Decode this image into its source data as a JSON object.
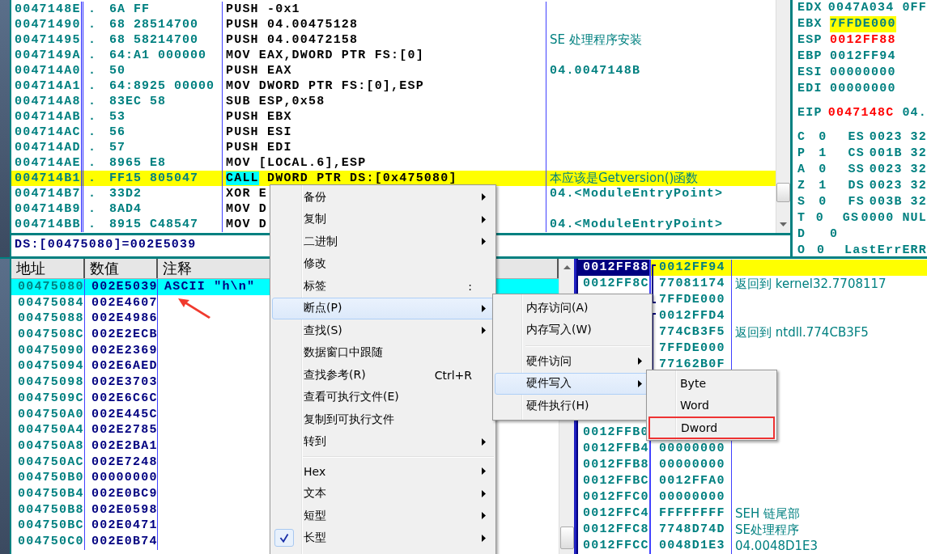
{
  "disassembly": {
    "rows": [
      {
        "address": "0047148E",
        "dot": ".",
        "hex": "6A FF",
        "mnemonic": "PUSH",
        "operands": "-0x1",
        "selected": false
      },
      {
        "address": "00471490",
        "dot": ".",
        "hex": "68 28514700",
        "mnemonic": "PUSH",
        "operands": "04.00475128",
        "selected": false
      },
      {
        "address": "00471495",
        "dot": ".",
        "hex": "68 58214700",
        "mnemonic": "PUSH",
        "operands": "04.00472158",
        "comment": "SE 处理程序安装",
        "selected": false
      },
      {
        "address": "0047149A",
        "dot": ".",
        "hex": "64:A1 000000",
        "mnemonic": "MOV",
        "operands": "EAX,DWORD PTR FS:[0]",
        "selected": false
      },
      {
        "address": "004714A0",
        "dot": ".",
        "hex": "50",
        "mnemonic": "PUSH",
        "operands": "EAX",
        "comment": "04.0047148B",
        "selected": false
      },
      {
        "address": "004714A1",
        "dot": ".",
        "hex": "64:8925 00000",
        "mnemonic": "MOV",
        "operands": "DWORD PTR FS:[0],ESP",
        "selected": false
      },
      {
        "address": "004714A8",
        "dot": ".",
        "hex": "83EC 58",
        "mnemonic": "SUB",
        "operands": "ESP,0x58",
        "selected": false
      },
      {
        "address": "004714AB",
        "dot": ".",
        "hex": "53",
        "mnemonic": "PUSH",
        "operands": "EBX",
        "selected": false
      },
      {
        "address": "004714AC",
        "dot": ".",
        "hex": "56",
        "mnemonic": "PUSH",
        "operands": "ESI",
        "selected": false
      },
      {
        "address": "004714AD",
        "dot": ".",
        "hex": "57",
        "mnemonic": "PUSH",
        "operands": "EDI",
        "selected": false
      },
      {
        "address": "004714AE",
        "dot": ".",
        "hex": "8965 E8",
        "mnemonic": "MOV",
        "operands": "[LOCAL.6],ESP",
        "selected": false
      },
      {
        "address": "004714B1",
        "dot": ".",
        "hex": "FF15 805047",
        "mnemonic": "CALL",
        "operands": "DWORD PTR DS:[0x475080]",
        "comment": "本应该是Getversion()函数",
        "selected": true,
        "mnemonic_marked": true
      },
      {
        "address": "004714B7",
        "dot": ".",
        "hex": "33D2",
        "mnemonic": "XOR",
        "operands": "E",
        "comment": "04.<ModuleEntryPoint>",
        "selected": false
      },
      {
        "address": "004714B9",
        "dot": ".",
        "hex": "8AD4",
        "mnemonic": "MOV",
        "operands": "D",
        "selected": false
      },
      {
        "address": "004714BB",
        "dot": ".",
        "hex": "8915 C48547",
        "mnemonic": "MOV",
        "operands": "D",
        "comment": "04.<ModuleEntryPoint>",
        "selected": false
      }
    ],
    "info": "DS:[00475080]=002E5039"
  },
  "register_groups": [
    {
      "rows": [
        {
          "name": "EDX",
          "value": "0047A034",
          "extra": "0FF",
          "kind": "plain"
        },
        {
          "name": "EBX",
          "value": "7FFDE000",
          "kind": "highlight"
        },
        {
          "name": "ESP",
          "value": "0012FF88",
          "kind": "changed"
        },
        {
          "name": "EBP",
          "value": "0012FF94",
          "kind": "plain"
        },
        {
          "name": "ESI",
          "value": "00000000",
          "kind": "plain"
        },
        {
          "name": "EDI",
          "value": "00000000",
          "kind": "plain"
        }
      ]
    },
    {
      "rows": [
        {
          "name": "EIP",
          "value": "0047148C",
          "extra": "04.",
          "kind": "changed"
        }
      ]
    },
    {
      "rows": [
        {
          "name": "C",
          "value": "0",
          "segment": "ES",
          "seg_value": "0023",
          "extra": "32",
          "kind": "flag"
        },
        {
          "name": "P",
          "value": "1",
          "segment": "CS",
          "seg_value": "001B",
          "extra": "32",
          "kind": "flag"
        },
        {
          "name": "A",
          "value": "0",
          "segment": "SS",
          "seg_value": "0023",
          "extra": "32",
          "kind": "flag"
        },
        {
          "name": "Z",
          "value": "1",
          "segment": "DS",
          "seg_value": "0023",
          "extra": "32",
          "kind": "flag"
        },
        {
          "name": "S",
          "value": "0",
          "segment": "FS",
          "seg_value": "003B",
          "extra": "32",
          "kind": "flag"
        },
        {
          "name": "T",
          "value": "0",
          "segment": "GS",
          "seg_value": "0000",
          "extra": "NUL",
          "kind": "flag"
        },
        {
          "name": "D",
          "value": "0",
          "kind": "flag"
        },
        {
          "name": "O",
          "value": "0",
          "segment": "LastErr",
          "seg_value": "ERR",
          "kind": "flag"
        }
      ]
    }
  ],
  "dump": {
    "columns": [
      "地址",
      "数值",
      "注释"
    ],
    "rows": [
      {
        "address": "00475080",
        "value": "002E5039",
        "comment": "ASCII \"h\\n\"",
        "selected": true
      },
      {
        "address": "00475084",
        "value": "002E4607",
        "selected": false
      },
      {
        "address": "00475088",
        "value": "002E4986",
        "selected": false
      },
      {
        "address": "0047508C",
        "value": "002E2ECB",
        "selected": false
      },
      {
        "address": "00475090",
        "value": "002E2369",
        "selected": false
      },
      {
        "address": "00475094",
        "value": "002E6AED",
        "selected": false
      },
      {
        "address": "00475098",
        "value": "002E3703",
        "selected": false
      },
      {
        "address": "0047509C",
        "value": "002E6C6C",
        "selected": false
      },
      {
        "address": "004750A0",
        "value": "002E445C",
        "selected": false
      },
      {
        "address": "004750A4",
        "value": "002E2785",
        "selected": false
      },
      {
        "address": "004750A8",
        "value": "002E2BA1",
        "selected": false
      },
      {
        "address": "004750AC",
        "value": "002E7248",
        "selected": false
      },
      {
        "address": "004750B0",
        "value": "00000000",
        "selected": false
      },
      {
        "address": "004750B4",
        "value": "002E0BC9",
        "selected": false
      },
      {
        "address": "004750B8",
        "value": "002E0598",
        "selected": false
      },
      {
        "address": "004750BC",
        "value": "002E0471",
        "selected": false
      },
      {
        "address": "004750C0",
        "value": "002E0B74",
        "selected": false
      }
    ]
  },
  "stack": {
    "upper_rows": [
      {
        "address": "0012FF88",
        "value": "0012FF94",
        "selected": true,
        "kind": "frame_top"
      },
      {
        "address": "0012FF8C",
        "value": "77081174",
        "comment": "返回到 kernel32.7708117",
        "selected": false,
        "kind": "frame_middle"
      },
      {
        "value": "7FFDE000",
        "selected": false,
        "kind": "frame_bottom"
      },
      {
        "value": "0012FFD4",
        "selected": false,
        "kind": "frame_top"
      },
      {
        "value": "774CB3F5",
        "comment": "返回到 ntdll.774CB3F5",
        "selected": false,
        "kind": "frame_middle"
      },
      {
        "value": "7FFDE000",
        "selected": false,
        "kind": "frame_middle"
      },
      {
        "value": "77162B0F",
        "selected": false,
        "kind": "frame_middle"
      }
    ],
    "lower_rows": [
      {
        "address": "0012FFB0",
        "selected": false
      },
      {
        "address": "0012FFB4",
        "value": "00000000",
        "selected": false
      },
      {
        "address": "0012FFB8",
        "value": "00000000",
        "selected": false
      },
      {
        "address": "0012FFBC",
        "value": "0012FFA0",
        "selected": false
      },
      {
        "address": "0012FFC0",
        "value": "00000000",
        "selected": false
      },
      {
        "address": "0012FFC4",
        "value": "FFFFFFFF",
        "comment": "SEH 链尾部",
        "selected": false
      },
      {
        "address": "0012FFC8",
        "value": "7748D74D",
        "comment": "SE处理程序",
        "selected": false
      },
      {
        "address": "0012FFCC",
        "value": "0048D1E3",
        "comment": "04.0048D1E3",
        "selected": false
      }
    ]
  },
  "context_menu": {
    "items": [
      {
        "kind": "item",
        "label": "备份",
        "submenu": true,
        "checked": false,
        "selected": false
      },
      {
        "kind": "item",
        "label": "复制",
        "submenu": true,
        "checked": false,
        "selected": false
      },
      {
        "kind": "item",
        "label": "二进制",
        "submenu": true,
        "checked": false,
        "selected": false
      },
      {
        "kind": "item",
        "label": "修改",
        "submenu": false,
        "checked": false,
        "selected": false
      },
      {
        "kind": "item",
        "label": "标签",
        "shortcut": ":",
        "submenu": false,
        "checked": false,
        "selected": false
      },
      {
        "kind": "item",
        "label": "断点(P)",
        "submenu": true,
        "checked": false,
        "selected": true
      },
      {
        "kind": "item",
        "label": "查找(S)",
        "submenu": true,
        "checked": false,
        "selected": false
      },
      {
        "kind": "item",
        "label": "数据窗口中跟随",
        "submenu": false,
        "checked": false,
        "selected": false
      },
      {
        "kind": "item",
        "label": "查找参考(R)",
        "shortcut": "Ctrl+R",
        "submenu": false,
        "checked": false,
        "selected": false
      },
      {
        "kind": "item",
        "label": "查看可执行文件(E)",
        "submenu": false,
        "checked": false,
        "selected": false
      },
      {
        "kind": "item",
        "label": "复制到可执行文件",
        "submenu": false,
        "checked": false,
        "selected": false
      },
      {
        "kind": "item",
        "label": "转到",
        "submenu": true,
        "checked": false,
        "selected": false
      },
      {
        "kind": "separator"
      },
      {
        "kind": "item",
        "label": "Hex",
        "submenu": true,
        "checked": false,
        "selected": false
      },
      {
        "kind": "item",
        "label": "文本",
        "submenu": true,
        "checked": false,
        "selected": false
      },
      {
        "kind": "item",
        "label": "短型",
        "submenu": true,
        "checked": false,
        "selected": false
      },
      {
        "kind": "item",
        "label": "长型",
        "submenu": true,
        "checked": true,
        "selected": false
      }
    ]
  },
  "breakpoint_menu": {
    "items": [
      {
        "kind": "item",
        "label": "内存访问(A)",
        "submenu": false,
        "selected": false
      },
      {
        "kind": "item",
        "label": "内存写入(W)",
        "submenu": false,
        "selected": false
      },
      {
        "kind": "separator"
      },
      {
        "kind": "item",
        "label": "硬件访问",
        "submenu": true,
        "selected": false
      },
      {
        "kind": "item",
        "label": "硬件写入",
        "submenu": true,
        "selected": true
      },
      {
        "kind": "item",
        "label": "硬件执行(H)",
        "submenu": false,
        "selected": false
      }
    ]
  },
  "size_menu": {
    "items": [
      {
        "kind": "item",
        "label": "Byte",
        "selected": false,
        "circled": false
      },
      {
        "kind": "item",
        "label": "Word",
        "selected": false,
        "circled": false
      },
      {
        "kind": "item",
        "label": "Dword",
        "selected": false,
        "circled": true
      }
    ]
  },
  "annotations": [
    {
      "kind": "arrow"
    }
  ]
}
